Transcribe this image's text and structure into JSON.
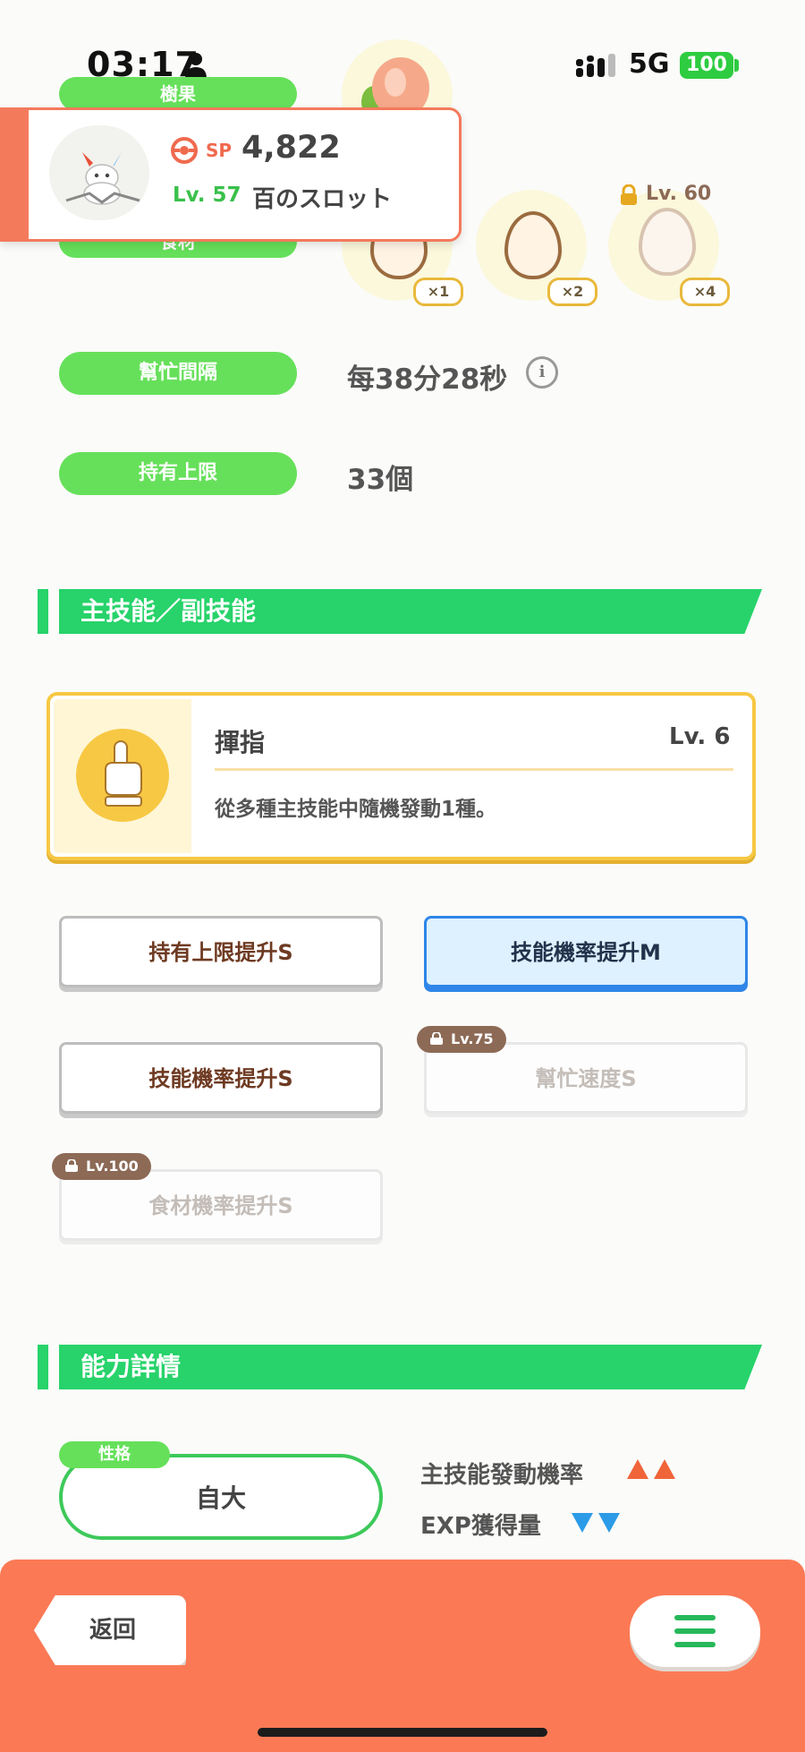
{
  "status_bar": {
    "time": "03:17",
    "network": "5G",
    "battery": "100"
  },
  "top_labels": {
    "berry": "樹果",
    "ingredient": "食材"
  },
  "eggs": {
    "counts": [
      "×1",
      "×2",
      "×4"
    ],
    "locked_level": "Lv. 60"
  },
  "popup": {
    "sp_label": "SP",
    "sp_value": "4,822",
    "level": "Lv. 57",
    "name": "百のスロット"
  },
  "help_interval": {
    "label": "幫忙間隔",
    "value": "每38分28秒"
  },
  "carry_limit": {
    "label": "持有上限",
    "value": "33個"
  },
  "skills_section": {
    "title": "主技能／副技能"
  },
  "main_skill": {
    "name": "揮指",
    "level": "Lv. 6",
    "description": "從多種主技能中隨機發動1種。"
  },
  "sub_skills": [
    {
      "label": "持有上限提升S",
      "state": "normal"
    },
    {
      "label": "技能機率提升M",
      "state": "selected"
    },
    {
      "label": "技能機率提升S",
      "state": "normal"
    },
    {
      "label": "幫忙速度S",
      "state": "locked",
      "lock_level": "Lv.75"
    },
    {
      "label": "食材機率提升S",
      "state": "locked",
      "lock_level": "Lv.100"
    }
  ],
  "ability_section": {
    "title": "能力詳情"
  },
  "nature": {
    "tag": "性格",
    "value": "自大",
    "up_effect": "主技能發動機率",
    "down_effect": "EXP獲得量",
    "up_color": "#f0643a",
    "down_color": "#2b9be8"
  },
  "bottom_bar": {
    "back_label": "返回"
  }
}
